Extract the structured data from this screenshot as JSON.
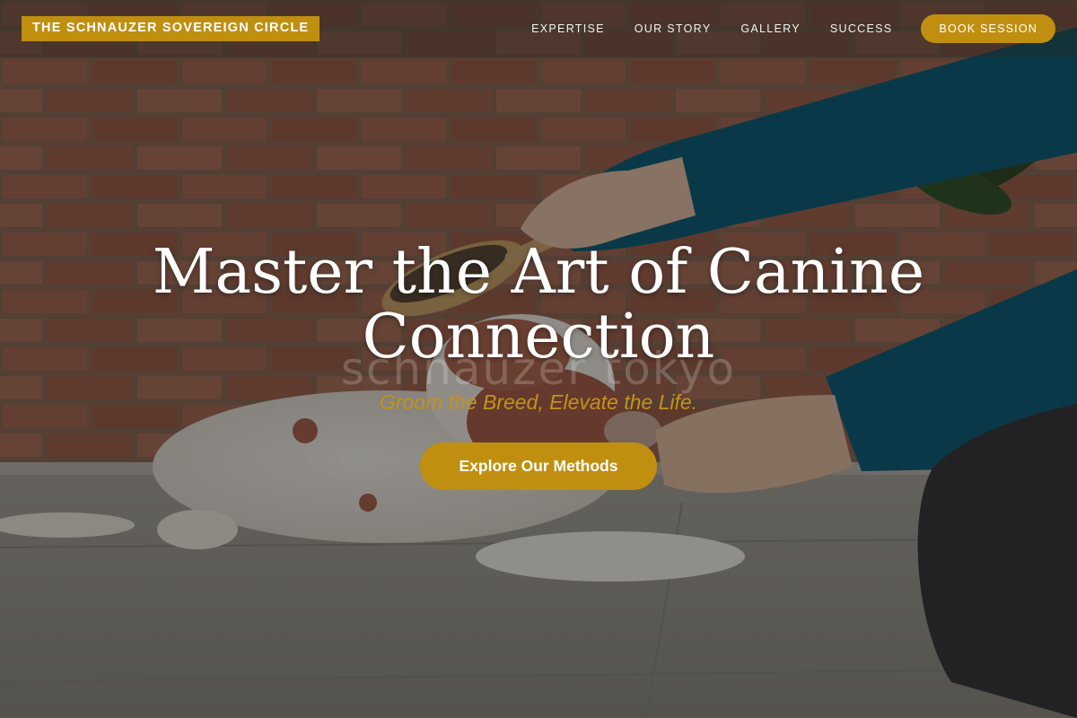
{
  "brand": {
    "name": "THE SCHNAUZER SOVEREIGN CIRCLE",
    "accent_color": "#c08f10"
  },
  "nav": {
    "items": [
      {
        "label": "EXPERTISE"
      },
      {
        "label": "OUR STORY"
      },
      {
        "label": "GALLERY"
      },
      {
        "label": "SUCCESS"
      }
    ],
    "cta_label": "BOOK SESSION"
  },
  "hero": {
    "background_image": "person brushing a dog lying on a tiled floor in front of a brick wall",
    "watermark": "schnauzer tokyo",
    "headline": "Master the Art of Canine Connection",
    "tagline": "Groom the Breed, Elevate the Life.",
    "cta_label": "Explore Our Methods"
  }
}
